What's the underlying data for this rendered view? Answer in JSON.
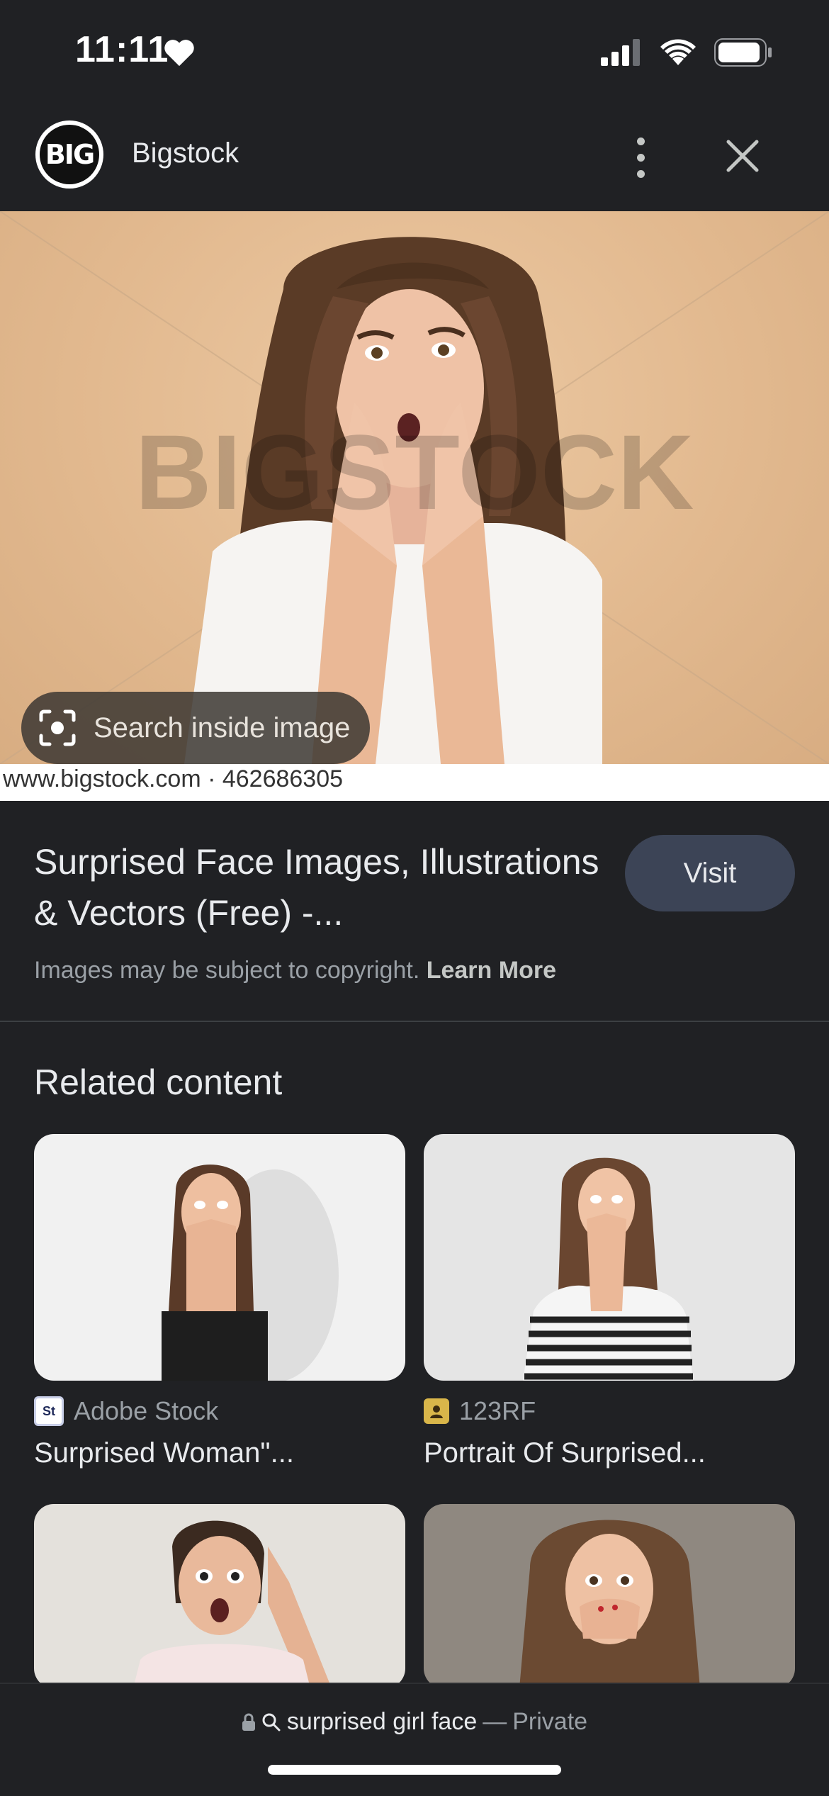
{
  "status_bar": {
    "time": "11:11"
  },
  "header": {
    "site_name": "Bigstock",
    "logo_text": "BIG"
  },
  "hero": {
    "watermark": "BIGSTOCK",
    "caption": "www.bigstock.com · 462686305",
    "lens_label": "Search inside image"
  },
  "result": {
    "title": "Surprised Face Images, Illustrations & Vectors (Free) -...",
    "visit_label": "Visit",
    "copyright_text": "Images may be subject to copyright.",
    "learn_more": "Learn More"
  },
  "related": {
    "title": "Related content",
    "items": [
      {
        "source": "Adobe Stock",
        "favicon": "St",
        "title": "Surprised Woman\"..."
      },
      {
        "source": "123RF",
        "favicon": "",
        "title": "Portrait Of Surprised..."
      }
    ]
  },
  "bottom": {
    "query": "surprised girl face",
    "separator": "—",
    "mode": "Private"
  }
}
